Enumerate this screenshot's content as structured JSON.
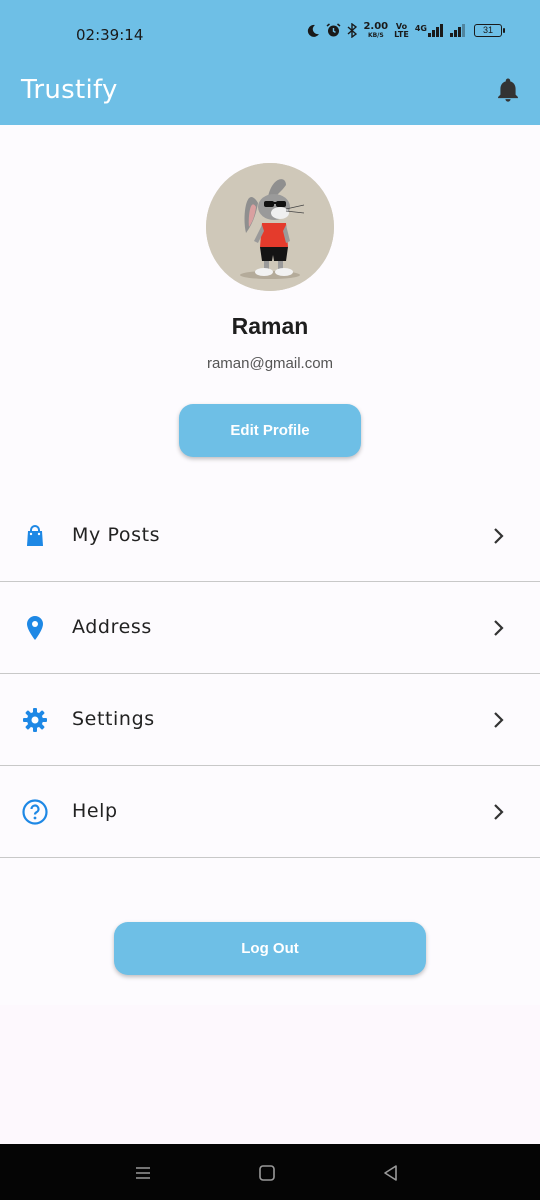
{
  "status_bar": {
    "time": "02:39:14",
    "net_speed_value": "2.00",
    "net_speed_unit": "KB/S",
    "volte_top": "Vo",
    "volte_bottom": "LTE",
    "network_type": "4G",
    "battery_level": "31"
  },
  "app_bar": {
    "title": "Trustify",
    "bell_icon": "notifications-icon"
  },
  "profile": {
    "name": "Raman",
    "email": "raman@gmail.com",
    "edit_label": "Edit Profile"
  },
  "menu": {
    "items": [
      {
        "label": "My Posts",
        "icon": "shopping-bag-icon"
      },
      {
        "label": "Address",
        "icon": "location-pin-icon"
      },
      {
        "label": "Settings",
        "icon": "gear-icon"
      },
      {
        "label": "Help",
        "icon": "help-circle-icon"
      }
    ]
  },
  "logout_label": "Log Out",
  "colors": {
    "primary": "#6ebfe6",
    "icon_blue": "#1e88e5",
    "background": "#fdfbfe"
  }
}
